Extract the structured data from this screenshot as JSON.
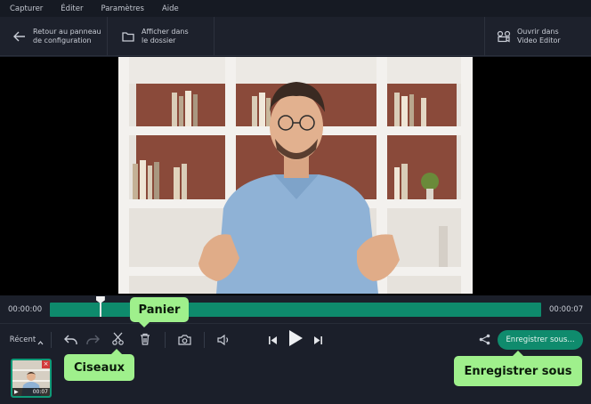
{
  "menu": {
    "items": [
      "Capturer",
      "Éditer",
      "Paramètres",
      "Aide"
    ]
  },
  "toolbar": {
    "back_label": "Retour au panneau\nde configuration",
    "folder_label": "Afficher dans\nle dossier",
    "editor_label": "Ouvrir dans\nVideo Editor"
  },
  "timeline": {
    "start_time": "00:00:00",
    "end_time": "00:00:07",
    "playhead_fraction": 0.103
  },
  "controls": {
    "recent_label": "Récent",
    "save_label": "Enregistrer sous..."
  },
  "clip": {
    "duration": "00:07"
  },
  "callouts": {
    "panier": "Panier",
    "ciseaux": "Ciseaux",
    "enregistrer": "Enregistrer sous"
  },
  "icons": {
    "back": "arrow-left-icon",
    "folder": "folder-icon",
    "editor": "video-editor-icon",
    "undo": "undo-icon",
    "redo": "redo-icon",
    "cut": "scissors-icon",
    "delete": "trash-icon",
    "snapshot": "camera-icon",
    "volume": "volume-icon",
    "prev": "skip-back-icon",
    "play": "play-icon",
    "next": "skip-forward-icon",
    "share": "share-icon"
  },
  "colors": {
    "accent": "#0f8b6d",
    "callout": "#9ff08c",
    "background": "#1b1f2a"
  }
}
